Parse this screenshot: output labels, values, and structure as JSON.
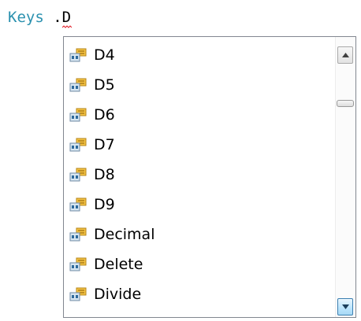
{
  "editor": {
    "type_name": "Keys",
    "dot": ".",
    "member_typed": "D"
  },
  "completion": {
    "item_icon": "enum-member-icon",
    "items": [
      "D4",
      "D5",
      "D6",
      "D7",
      "D8",
      "D9",
      "Decimal",
      "Delete",
      "Divide"
    ]
  },
  "scrollbar": {
    "up_icon": "scroll-up-arrow-icon",
    "down_icon": "scroll-down-arrow-icon"
  },
  "colors": {
    "type_name": "#2b91af",
    "error_squiggle": "#e0212b",
    "list_border": "#828790",
    "scroll_down_active": "#a7d9f5"
  }
}
